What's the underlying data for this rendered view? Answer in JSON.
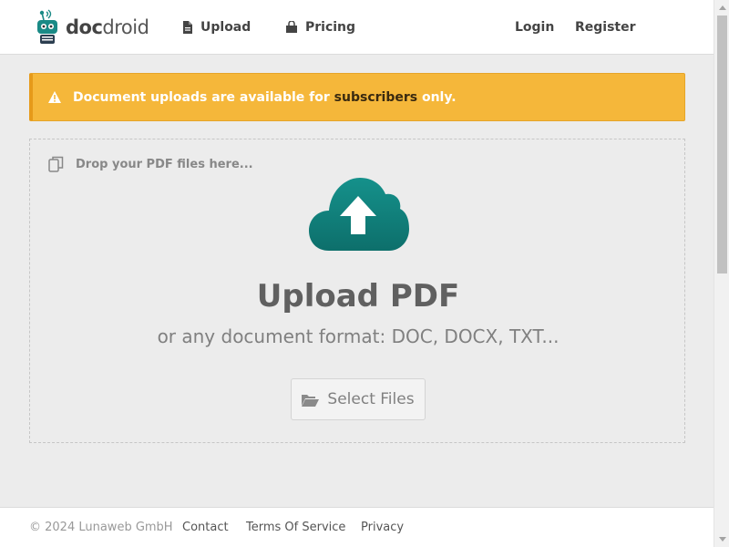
{
  "header": {
    "logo": {
      "bold": "doc",
      "normal": "droid"
    },
    "nav": {
      "upload": "Upload",
      "pricing": "Pricing",
      "login": "Login",
      "register": "Register"
    }
  },
  "alert": {
    "prefix": "Document uploads are available for ",
    "highlight": "subscribers",
    "suffix": " only."
  },
  "dropzone": {
    "hint": "Drop your PDF files here...",
    "title": "Upload PDF",
    "subtitle": "or any document format: DOC, DOCX, TXT...",
    "button": "Select Files"
  },
  "footer": {
    "copyright": "© 2024 Lunaweb GmbH",
    "contact": "Contact",
    "terms": "Terms Of Service",
    "privacy": "Privacy"
  },
  "colors": {
    "accent_teal": "#12807b",
    "alert_bg": "#f5b73a"
  }
}
